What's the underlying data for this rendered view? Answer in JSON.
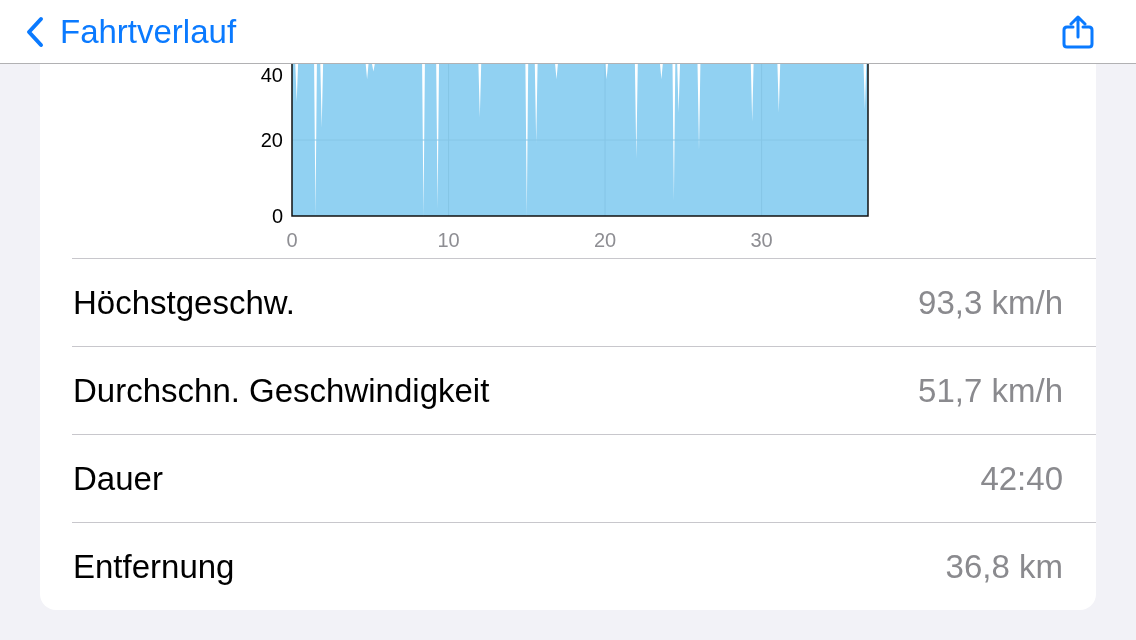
{
  "nav": {
    "back_label": "Fahrtverlauf"
  },
  "chart": {
    "chart_data": {
      "type": "area",
      "xticks": [
        0,
        10,
        20,
        30
      ],
      "yticks": [
        0,
        20,
        40
      ],
      "xlim": [
        0,
        36.8
      ],
      "ylim": [
        0,
        40
      ],
      "grid": true
    }
  },
  "stats": [
    {
      "label": "Höchstgeschw.",
      "value": "93,3 km/h"
    },
    {
      "label": "Durchschn. Geschwindigkeit",
      "value": "51,7 km/h"
    },
    {
      "label": "Dauer",
      "value": "42:40"
    },
    {
      "label": "Entfernung",
      "value": "36,8 km"
    }
  ]
}
